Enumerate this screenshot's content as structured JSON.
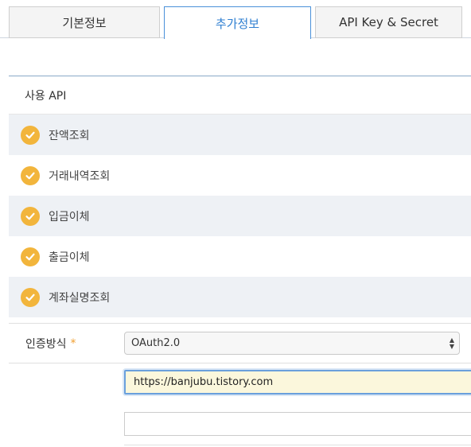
{
  "tabs": [
    {
      "label": "기본정보",
      "active": false
    },
    {
      "label": "추가정보",
      "active": true
    },
    {
      "label": "API Key & Secret",
      "active": false
    }
  ],
  "api_section": {
    "header": "사용 API",
    "items": [
      {
        "label": "잔액조회",
        "checked": true
      },
      {
        "label": "거래내역조회",
        "checked": true
      },
      {
        "label": "입금이체",
        "checked": true
      },
      {
        "label": "출금이체",
        "checked": true
      },
      {
        "label": "계좌실명조회",
        "checked": true
      }
    ]
  },
  "auth": {
    "label": "인증방식",
    "required_mark": "*",
    "selected": "OAuth2.0"
  },
  "callback_url": {
    "value": "https://banjubu.tistory.com"
  },
  "extra_input": {
    "value": ""
  },
  "colors": {
    "accent": "#2f7fd1",
    "check": "#f2b53c",
    "required": "#f0a030",
    "input_highlight": "#fbf7dc"
  },
  "icons": [
    "check-circle-icon",
    "select-arrows-icon"
  ]
}
